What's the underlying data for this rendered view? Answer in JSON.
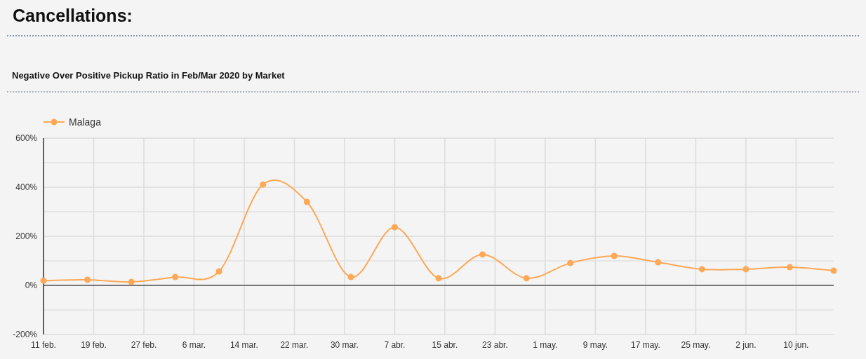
{
  "heading": "Cancellations:",
  "panel": {
    "title": "Negative Over Positive Pickup Ratio in Feb/Mar 2020 by Market",
    "chart_data": {
      "type": "line",
      "x": [
        "2020-02-11",
        "2020-02-18",
        "2020-02-25",
        "2020-03-03",
        "2020-03-10",
        "2020-03-17",
        "2020-03-24",
        "2020-03-31",
        "2020-04-07",
        "2020-04-14",
        "2020-04-21",
        "2020-04-28",
        "2020-05-05",
        "2020-05-12",
        "2020-05-19",
        "2020-05-26",
        "2020-06-02",
        "2020-06-09",
        "2020-06-16"
      ],
      "grid": true,
      "series": [
        {
          "name": "Malaga",
          "color": "#ffa857",
          "marker": "circle",
          "values": [
            19,
            23,
            14,
            34,
            57,
            411,
            340,
            34,
            237,
            29,
            126,
            29,
            91,
            120,
            94,
            66,
            66,
            74,
            60
          ]
        }
      ],
      "xlim": [
        "2020-02-11",
        "2020-06-16"
      ],
      "ylim": [
        -200,
        600
      ],
      "xticks": [
        {
          "value": "2020-02-11",
          "label": "11 feb."
        },
        {
          "value": "2020-02-19",
          "label": "19 feb."
        },
        {
          "value": "2020-02-27",
          "label": "27 feb."
        },
        {
          "value": "2020-03-06",
          "label": "6 mar."
        },
        {
          "value": "2020-03-14",
          "label": "14 mar."
        },
        {
          "value": "2020-03-22",
          "label": "22 mar."
        },
        {
          "value": "2020-03-30",
          "label": "30 mar."
        },
        {
          "value": "2020-04-07",
          "label": "7 abr."
        },
        {
          "value": "2020-04-15",
          "label": "15 abr."
        },
        {
          "value": "2020-04-23",
          "label": "23 abr."
        },
        {
          "value": "2020-05-01",
          "label": "1 may."
        },
        {
          "value": "2020-05-09",
          "label": "9 may."
        },
        {
          "value": "2020-05-17",
          "label": "17 may."
        },
        {
          "value": "2020-05-25",
          "label": "25 may."
        },
        {
          "value": "2020-06-02",
          "label": "2 jun."
        },
        {
          "value": "2020-06-10",
          "label": "10 jun."
        }
      ],
      "yticks": [
        {
          "value": -200,
          "label": "-200%"
        },
        {
          "value": 0,
          "label": "0%"
        },
        {
          "value": 200,
          "label": "200%"
        },
        {
          "value": 400,
          "label": "400%"
        },
        {
          "value": 600,
          "label": "600%"
        }
      ]
    }
  }
}
